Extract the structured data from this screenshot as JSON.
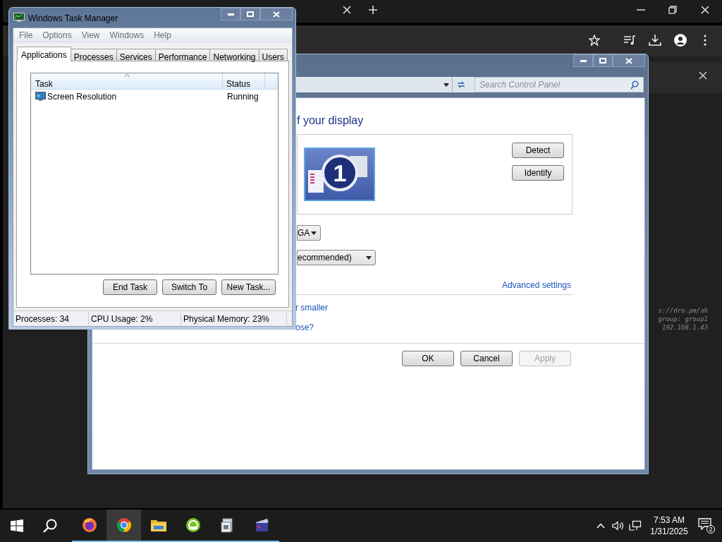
{
  "control_panel": {
    "search": {
      "placeholder": "Search Control Panel"
    },
    "heading": "f your display",
    "display_number": "1",
    "side_buttons": [
      {
        "label": "Detect"
      },
      {
        "label": "Identify"
      }
    ],
    "dropdowns": [
      {
        "value": "GA"
      },
      {
        "value": "ecommended)"
      }
    ],
    "advanced_link": "Advanced settings",
    "links": [
      "r smaller",
      "ose?"
    ],
    "buttons": [
      {
        "label": "OK",
        "disabled": false
      },
      {
        "label": "Cancel",
        "disabled": false
      },
      {
        "label": "Apply",
        "disabled": true
      }
    ]
  },
  "terminal_lines": [
    "s://dro.pm/ah",
    "group: group1",
    "192.168.1.43"
  ],
  "task_manager": {
    "title": "Windows Task Manager",
    "menu": [
      "File",
      "Options",
      "View",
      "Windows",
      "Help"
    ],
    "tabs": [
      {
        "label": "Applications",
        "selected": true
      },
      {
        "label": "Processes",
        "selected": false
      },
      {
        "label": "Services",
        "selected": false
      },
      {
        "label": "Performance",
        "selected": false
      },
      {
        "label": "Networking",
        "selected": false
      },
      {
        "label": "Users",
        "selected": false
      }
    ],
    "columns": [
      "Task",
      "Status"
    ],
    "rows": [
      {
        "task": "Screen Resolution",
        "status": "Running"
      }
    ],
    "buttons": [
      "End Task",
      "Switch To",
      "New Task..."
    ],
    "status_bar": [
      "Processes: 34",
      "CPU Usage: 2%",
      "Physical Memory: 23%"
    ]
  },
  "taskbar": {
    "apps": [
      {
        "kind": "firefox",
        "selected": false
      },
      {
        "kind": "chrome",
        "selected": true
      },
      {
        "kind": "folder",
        "selected": false
      },
      {
        "kind": "disc",
        "selected": false
      },
      {
        "kind": "document",
        "selected": false
      },
      {
        "kind": "film",
        "selected": false
      }
    ],
    "time": "7:53 AM",
    "date": "1/31/2025",
    "notification_count": "2"
  }
}
